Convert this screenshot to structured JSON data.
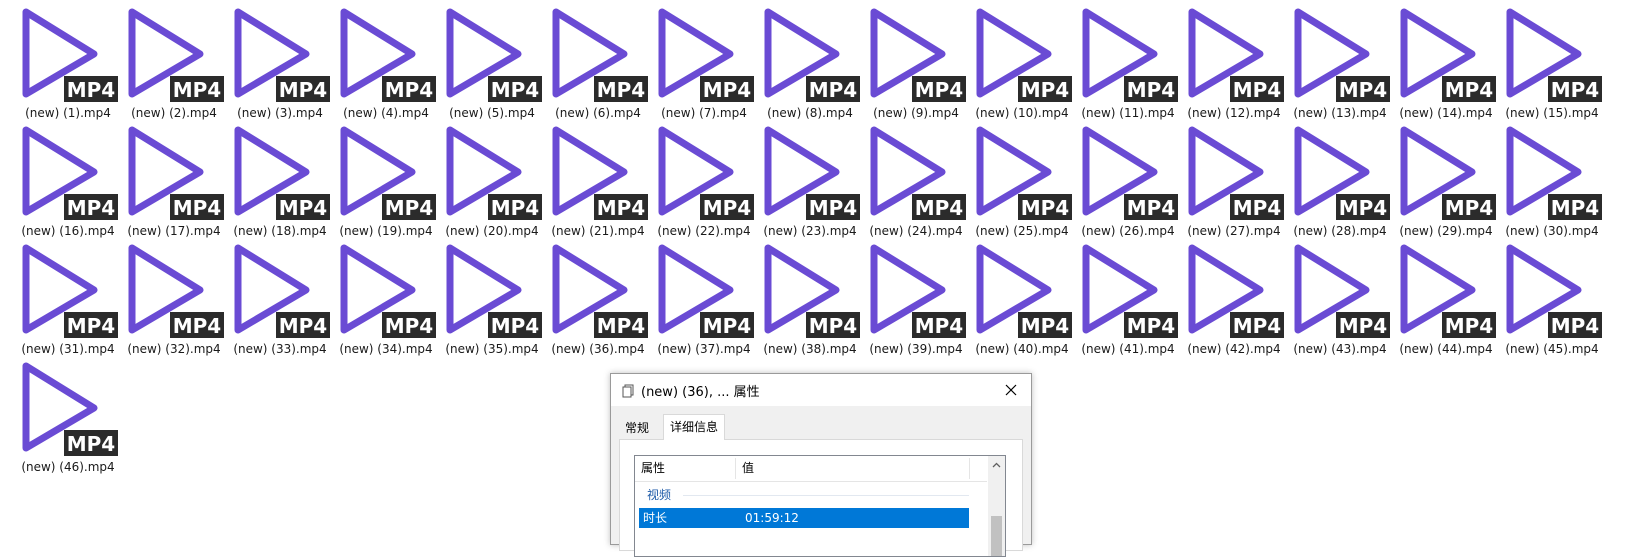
{
  "files": [
    "(new) (1).mp4",
    "(new) (2).mp4",
    "(new) (3).mp4",
    "(new) (4).mp4",
    "(new) (5).mp4",
    "(new) (6).mp4",
    "(new) (7).mp4",
    "(new) (8).mp4",
    "(new) (9).mp4",
    "(new) (10).mp4",
    "(new) (11).mp4",
    "(new) (12).mp4",
    "(new) (13).mp4",
    "(new) (14).mp4",
    "(new) (15).mp4",
    "(new) (16).mp4",
    "(new) (17).mp4",
    "(new) (18).mp4",
    "(new) (19).mp4",
    "(new) (20).mp4",
    "(new) (21).mp4",
    "(new) (22).mp4",
    "(new) (23).mp4",
    "(new) (24).mp4",
    "(new) (25).mp4",
    "(new) (26).mp4",
    "(new) (27).mp4",
    "(new) (28).mp4",
    "(new) (29).mp4",
    "(new) (30).mp4",
    "(new) (31).mp4",
    "(new) (32).mp4",
    "(new) (33).mp4",
    "(new) (34).mp4",
    "(new) (35).mp4",
    "(new) (36).mp4",
    "(new) (37).mp4",
    "(new) (38).mp4",
    "(new) (39).mp4",
    "(new) (40).mp4",
    "(new) (41).mp4",
    "(new) (42).mp4",
    "(new) (43).mp4",
    "(new) (44).mp4",
    "(new) (45).mp4",
    "(new) (46).mp4"
  ],
  "file_badge": "MP4",
  "file_icon": "play-triangle-icon",
  "colors": {
    "icon_purple": "#6A4BD4",
    "badge_bg": "#2b2b2b",
    "selection_blue": "#0078d7"
  },
  "dialog": {
    "title": "(new) (36), ... 属性",
    "tabs": [
      "常规",
      "详细信息"
    ],
    "active_tab": "详细信息",
    "columns": {
      "property": "属性",
      "value": "值"
    },
    "group": "视频",
    "selected_row": {
      "property": "时长",
      "value": "01:59:12"
    }
  }
}
